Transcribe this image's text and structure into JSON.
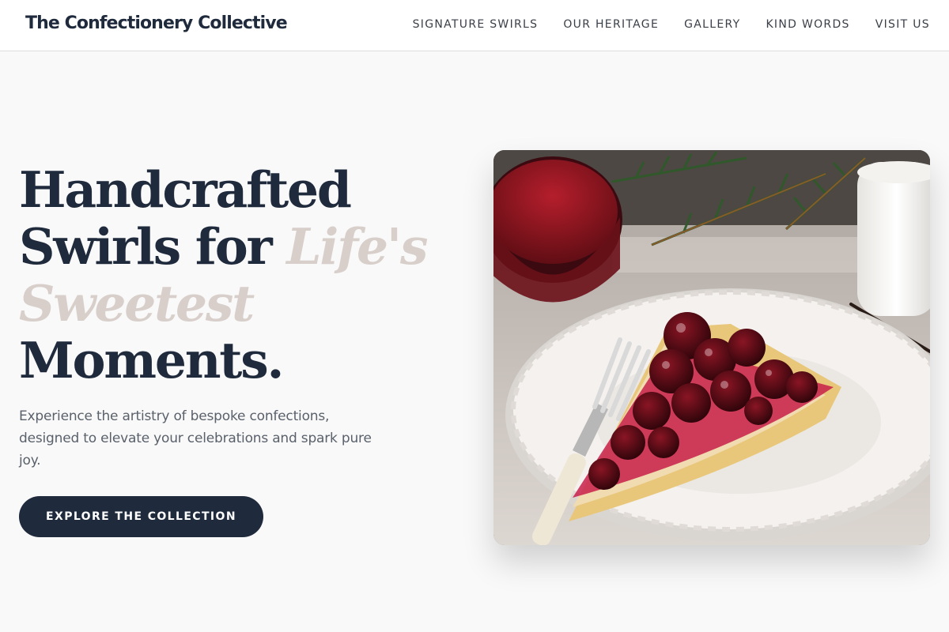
{
  "header": {
    "brand": "The Confectionery Collective",
    "nav": [
      {
        "label": "SIGNATURE SWIRLS"
      },
      {
        "label": "OUR HERITAGE"
      },
      {
        "label": "GALLERY"
      },
      {
        "label": "KIND WORDS"
      },
      {
        "label": "VISIT US"
      }
    ]
  },
  "hero": {
    "title_line1": "Handcrafted",
    "title_line2_plain": "Swirls for ",
    "title_line2_accent": "Life's",
    "title_line3_accent": "Sweetest",
    "title_line4": "Moments.",
    "subtitle": "Experience the artistry of bespoke confections, designed to elevate your celebrations and spark pure joy.",
    "cta_label": "EXPLORE THE COLLECTION",
    "image_alt": "Slice of cherry tart on a white ornate plate with a fork"
  },
  "colors": {
    "primary": "#1f2a3c",
    "accent": "#d8cfcb",
    "background": "#f9f9f9"
  }
}
